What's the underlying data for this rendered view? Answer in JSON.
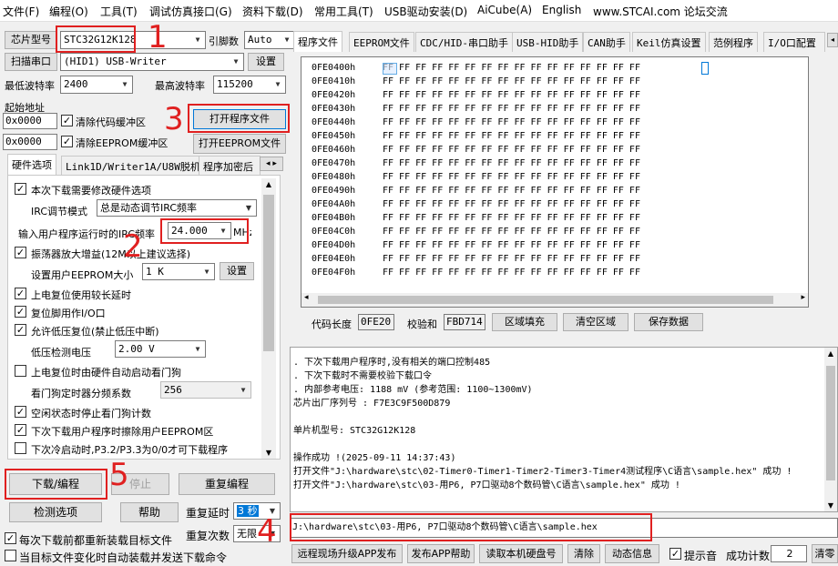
{
  "menu": [
    "文件(F)",
    "编程(O)",
    "工具(T)",
    "调试仿真接口(G)",
    "资料下载(D)",
    "常用工具(T)",
    "USB驱动安装(D)",
    "AiCube(A)",
    "English",
    "www.STCAI.com 论坛交流"
  ],
  "chip": {
    "label": "芯片型号",
    "value": "STC32G12K128",
    "pins_label": "引脚数",
    "pins_value": "Auto"
  },
  "port": {
    "scan_button": "扫描串口",
    "value": "(HID1) USB-Writer",
    "settings_button": "设置"
  },
  "baud": {
    "min_label": "最低波特率",
    "min_value": "2400",
    "max_label": "最高波特率",
    "max_value": "115200"
  },
  "start": {
    "label": "起始地址",
    "code_addr": "0x0000",
    "code_clear": "清除代码缓冲区",
    "open_prog": "打开程序文件",
    "eeprom_addr": "0x0000",
    "eeprom_clear": "清除EEPROM缓冲区",
    "open_eeprom": "打开EEPROM文件"
  },
  "left_tabs": [
    "硬件选项",
    "Link1D/Writer1A/U8W脱机",
    "程序加密后"
  ],
  "options": {
    "modify_hw": "本次下载需要修改硬件选项",
    "irc_mode_label": "IRC调节模式",
    "irc_mode_value": "总是动态调节IRC频率",
    "irc_freq_label": "输入用户程序运行时的IRC频率",
    "irc_freq_value": "24.000",
    "irc_freq_unit": "MHz",
    "osc_gain": "振荡器放大增益(12M以上建议选择)",
    "eeprom_size_label": "设置用户EEPROM大小",
    "eeprom_size_value": "1  K",
    "eeprom_set": "设置",
    "por_delay": "上电复位使用较长延时",
    "reset_io": "复位脚用作I/O口",
    "lvr": "允许低压复位(禁止低压中断)",
    "lvd_label": "低压检测电压",
    "lvd_value": "2.00 V",
    "wdt_auto": "上电复位时由硬件自动启动看门狗",
    "wdt_div_label": "看门狗定时器分频系数",
    "wdt_div_value": "256",
    "idle_wdt": "空闲状态时停止看门狗计数",
    "erase_eeprom": "下次下载用户程序时擦除用户EEPROM区",
    "p32p33": "下次冷启动时,P3.2/P3.3为0/0才可下载程序"
  },
  "actions": {
    "download": "下载/编程",
    "stop": "停止",
    "reprogram": "重复编程",
    "detect": "检测选项",
    "help": "帮助",
    "repeat_delay_label": "重复延时",
    "repeat_delay_value": "3 秒",
    "repeat_count_label": "重复次数",
    "repeat_count_value": "无限",
    "reload_each": "每次下载前都重新装载目标文件",
    "auto_reload": "当目标文件变化时自动装载并发送下载命令"
  },
  "right_tabs": [
    "程序文件",
    "EEPROM文件",
    "CDC/HID-串口助手",
    "USB-HID助手",
    "CAN助手",
    "Keil仿真设置",
    "范例程序",
    "I/O口配置"
  ],
  "hex": {
    "rows": [
      "0FE0400h",
      "0FE0410h",
      "0FE0420h",
      "0FE0430h",
      "0FE0440h",
      "0FE0450h",
      "0FE0460h",
      "0FE0470h",
      "0FE0480h",
      "0FE0490h",
      "0FE04A0h",
      "0FE04B0h",
      "0FE04C0h",
      "0FE04D0h",
      "0FE04E0h",
      "0FE04F0h"
    ],
    "bytes": "FF FF FF FF FF FF FF FF FF FF FF FF FF FF FF FF"
  },
  "hex_footer": {
    "code_len_label": "代码长度",
    "code_len_value": "0FE20",
    "checksum_label": "校验和",
    "checksum_value": "FBD714",
    "fill": "区域填充",
    "clear": "清空区域",
    "save": "保存数据"
  },
  "log": [
    "  . 下次下载用户程序时,没有相关的端口控制485",
    "  . 下次下载时不需要校验下载口令",
    "  . 内部参考电压: 1188 mV (参考范围: 1100~1300mV)",
    "芯片出厂序列号 : F7E3C9F500D879",
    "",
    "  单片机型号: STC32G12K128",
    "",
    "操作成功 !(2025-09-11 14:37:43)",
    "打开文件\"J:\\hardware\\stc\\02-Timer0-Timer1-Timer2-Timer3-Timer4测试程序\\C语言\\sample.hex\" 成功 !",
    "打开文件\"J:\\hardware\\stc\\03-用P6, P7口驱动8个数码管\\C语言\\sample.hex\" 成功 !"
  ],
  "path_value": "J:\\hardware\\stc\\03-用P6, P7口驱动8个数码管\\C语言\\sample.hex",
  "bottom": {
    "remote": "远程现场升级APP发布",
    "publish_help": "发布APP帮助",
    "read_disk": "读取本机硬盘号",
    "clear": "清除",
    "anim": "动态信息",
    "tips": "提示音",
    "success_label": "成功计数",
    "success_value": "2",
    "clear_zero": "清零"
  },
  "annotations": [
    "1",
    "2",
    "3",
    "4",
    "5"
  ],
  "colors": {
    "highlight": "#e02020",
    "tab_active": "#ffffff",
    "selection": "#0078d7"
  }
}
